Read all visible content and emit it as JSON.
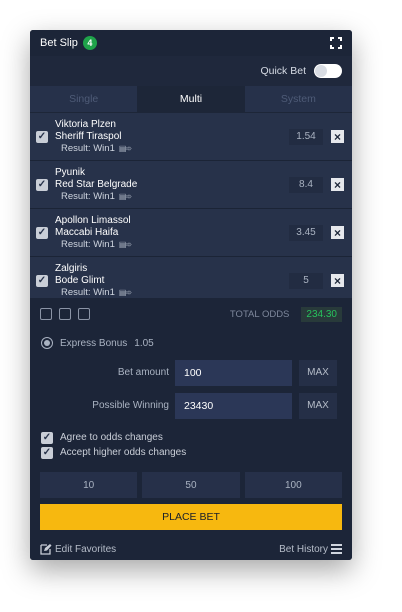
{
  "header": {
    "title": "Bet Slip",
    "count": "4"
  },
  "quick_bet": {
    "label": "Quick Bet",
    "enabled": false
  },
  "tabs": [
    {
      "label": "Single",
      "active": false
    },
    {
      "label": "Multi",
      "active": true
    },
    {
      "label": "System",
      "active": false
    }
  ],
  "bets": [
    {
      "home": "Viktoria Plzen",
      "away": "Sheriff Tiraspol",
      "result": "Result: Win1",
      "odds": "1.54",
      "checked": true
    },
    {
      "home": "Pyunik",
      "away": "Red Star Belgrade",
      "result": "Result: Win1",
      "odds": "8.4",
      "checked": true
    },
    {
      "home": "Apollon Limassol",
      "away": "Maccabi Haifa",
      "result": "Result: Win1",
      "odds": "3.45",
      "checked": true
    },
    {
      "home": "Zalgiris",
      "away": "Bode Glimt",
      "result": "Result: Win1",
      "odds": "5",
      "checked": true
    }
  ],
  "totals": {
    "label": "TOTAL ODDS",
    "value": "234.30"
  },
  "express_bonus": {
    "label": "Express Bonus",
    "value": "1.05"
  },
  "bet_amount": {
    "label": "Bet amount",
    "value": "100",
    "max_label": "MAX"
  },
  "possible_winning": {
    "label": "Possible Winning",
    "value": "23430",
    "max_label": "MAX"
  },
  "options": {
    "agree_odds": {
      "label": "Agree to odds changes",
      "checked": true
    },
    "accept_higher": {
      "label": "Accept higher odds changes",
      "checked": true
    }
  },
  "quick_amounts": [
    "10",
    "50",
    "100"
  ],
  "place_bet": "PLACE BET",
  "footer": {
    "edit_favorites": "Edit Favorites",
    "bet_history": "Bet History"
  },
  "colors": {
    "accent": "#f7b80f",
    "positive": "#27c25c",
    "badge": "#1fa34a",
    "panel": "#27324a"
  }
}
